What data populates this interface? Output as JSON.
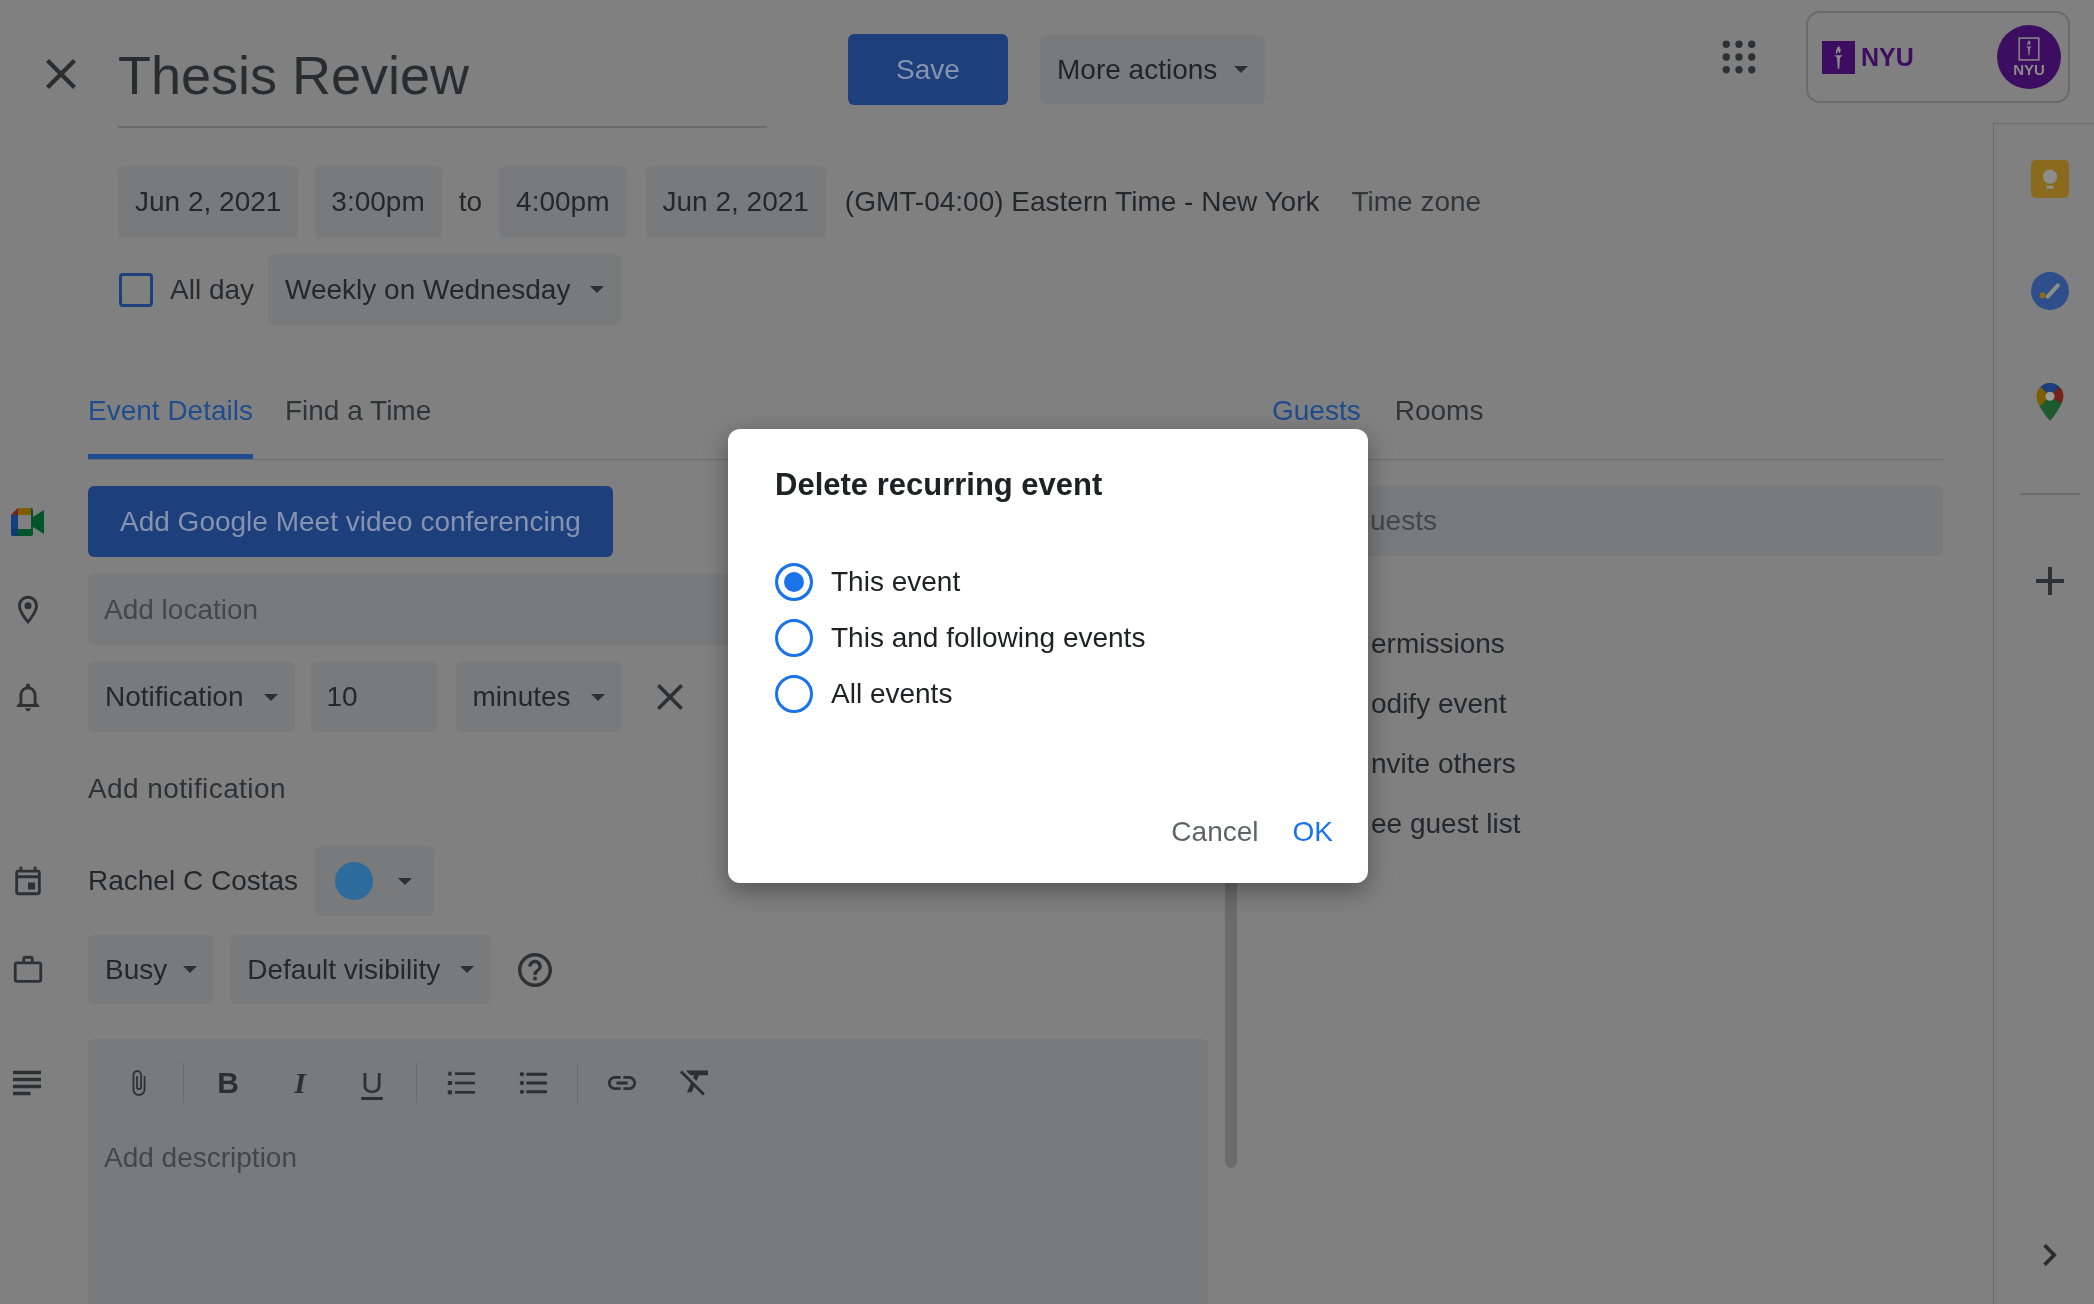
{
  "header": {
    "title": "Thesis Review",
    "save_button": "Save",
    "more_actions": "More actions"
  },
  "account": {
    "logo_text": "NYU",
    "avatar_text": "NYU"
  },
  "schedule": {
    "start_date": "Jun 2, 2021",
    "start_time": "3:00pm",
    "separator": "to",
    "end_time": "4:00pm",
    "end_date": "Jun 2, 2021",
    "timezone": "(GMT-04:00) Eastern Time - New York",
    "timezone_button": "Time zone"
  },
  "all_day": {
    "label": "All day",
    "checked": false
  },
  "recurrence": {
    "value": "Weekly on Wednesday"
  },
  "tabs": [
    {
      "label": "Event Details",
      "selected": true
    },
    {
      "label": "Find a Time",
      "selected": false
    }
  ],
  "details": {
    "meet_button": "Add Google Meet video conferencing",
    "location": {
      "placeholder": "Add location"
    },
    "notification": {
      "method": "Notification",
      "amount": "10",
      "unit": "minutes"
    },
    "add_notification": "Add notification",
    "calendar": {
      "owner": "Rachel C Costas",
      "color": "#2c6b9c"
    },
    "availability": "Busy",
    "visibility": "Default visibility",
    "format_buttons": [
      {
        "kind": "bold",
        "label": "B"
      },
      {
        "kind": "italic",
        "label": "I"
      },
      {
        "kind": "underline",
        "label": "U"
      }
    ],
    "description": {
      "placeholder": "Add description"
    }
  },
  "side_tabs": [
    {
      "label": "Guests",
      "selected": true
    },
    {
      "label": "Rooms",
      "selected": false
    }
  ],
  "guests": {
    "placeholder": "uests",
    "permissions_heading": "ermissions",
    "permissions": [
      "odify event",
      "nvite others",
      "ee guest list"
    ]
  },
  "dialog": {
    "title": "Delete recurring event",
    "options": [
      {
        "label": "This event",
        "selected": true
      },
      {
        "label": "This and following events",
        "selected": false
      },
      {
        "label": "All events",
        "selected": false
      }
    ],
    "cancel_button": "Cancel",
    "ok_button": "OK"
  }
}
